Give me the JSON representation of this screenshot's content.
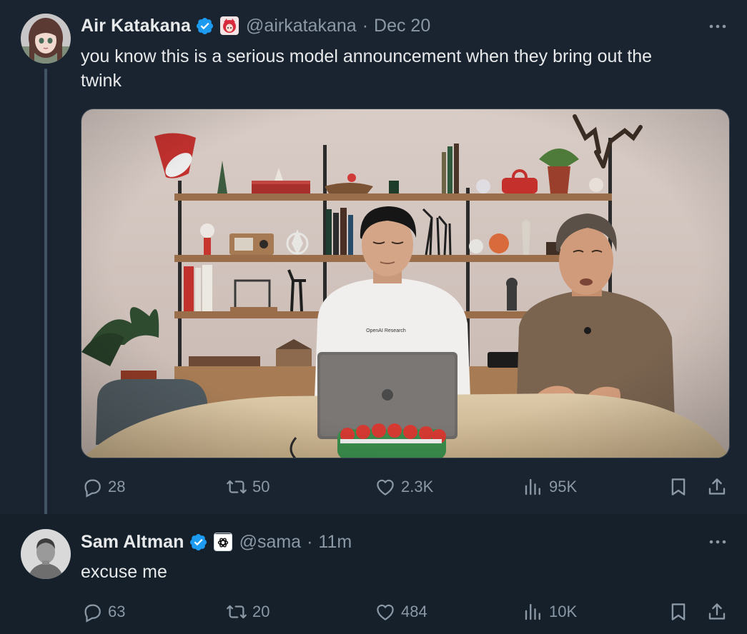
{
  "colors": {
    "background": "#15202b",
    "highlighted_background": "#1a2430",
    "text": "#e7e9ea",
    "secondary_text": "#8b98a5",
    "verified_blue": "#1d9bf0"
  },
  "tweets": [
    {
      "author": {
        "name": "Air Katakana",
        "handle": "@airkatakana",
        "verified": true,
        "affiliate_badge": "anime-avatar-badge"
      },
      "separator": "·",
      "time": "Dec 20",
      "text": "you know this is a serious model announcement when they bring out the\ntwink",
      "media_alt": "Two men seated at a wooden table with a laptop in front of holiday-decorated shelves",
      "actions": {
        "replies": "28",
        "reposts": "50",
        "likes": "2.3K",
        "views": "95K"
      }
    },
    {
      "author": {
        "name": "Sam Altman",
        "handle": "@sama",
        "verified": true,
        "affiliate_badge": "openai-badge"
      },
      "separator": "·",
      "time": "11m",
      "text": "excuse me",
      "actions": {
        "replies": "63",
        "reposts": "20",
        "likes": "484",
        "views": "10K"
      }
    }
  ],
  "icons": {
    "reply": "reply-icon",
    "repost": "repost-icon",
    "like": "like-icon",
    "views": "views-icon",
    "bookmark": "bookmark-icon",
    "share": "share-icon",
    "more": "more-icon"
  }
}
